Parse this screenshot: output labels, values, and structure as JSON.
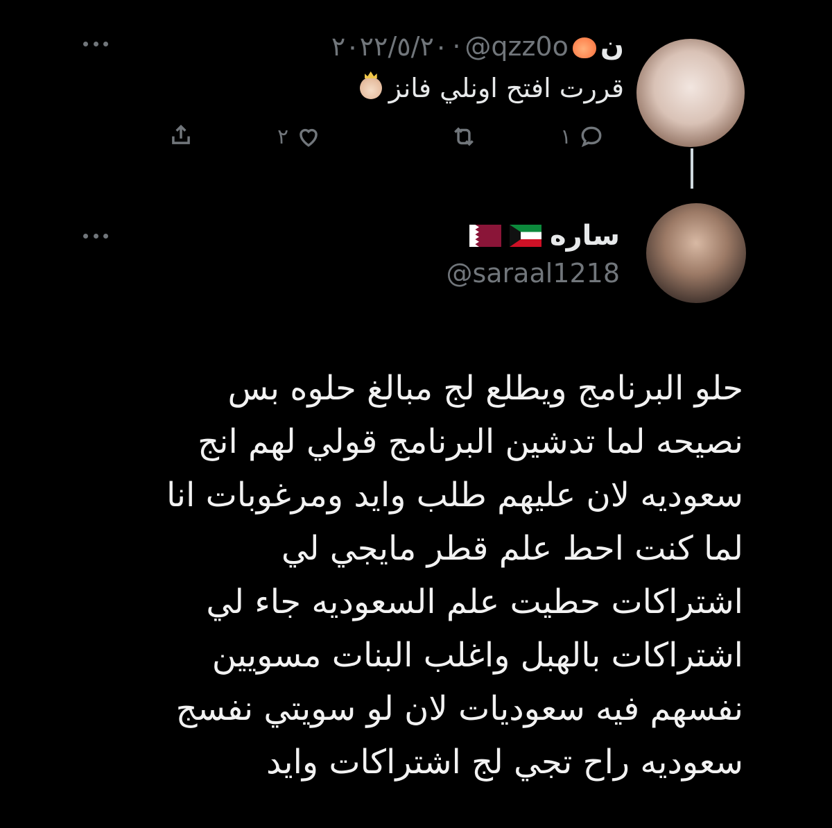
{
  "parent_tweet": {
    "display_name": "ن",
    "handle": "@qzz0o",
    "separator": "·",
    "date": "٢٠٢٢/٥/٢٠",
    "text": "قررت افتح اونلي فانز",
    "actions": {
      "reply_count": "١",
      "retweet_count": "",
      "like_count": "٢"
    }
  },
  "reply_tweet": {
    "display_name": "ساره",
    "handle": "@saraal1218",
    "body_lines": [
      "حلو البرنامج ويطلع لج مبالغ حلوه بس",
      "نصيحه لما تدشين البرنامج قولي لهم انج",
      "سعوديه لان عليهم طلب وايد ومرغوبات انا",
      "لما كنت احط علم قطر مايجي لي",
      "اشتراكات حطيت علم السعوديه جاء لي",
      "اشتراكات بالهبل واغلب البنات مسويين",
      "نفسهم فيه سعوديات لان لو سويتي نفسج",
      "سعوديه راح تجي لج اشتراكات وايد"
    ]
  },
  "colors": {
    "background": "#000000",
    "text": "#e7e9ea",
    "muted": "#71767b"
  },
  "icons": [
    "peach-emoji-icon",
    "princess-emoji-icon",
    "kuwait-flag-icon",
    "qatar-flag-icon",
    "reply-icon",
    "retweet-icon",
    "like-icon",
    "share-icon",
    "more-icon"
  ]
}
